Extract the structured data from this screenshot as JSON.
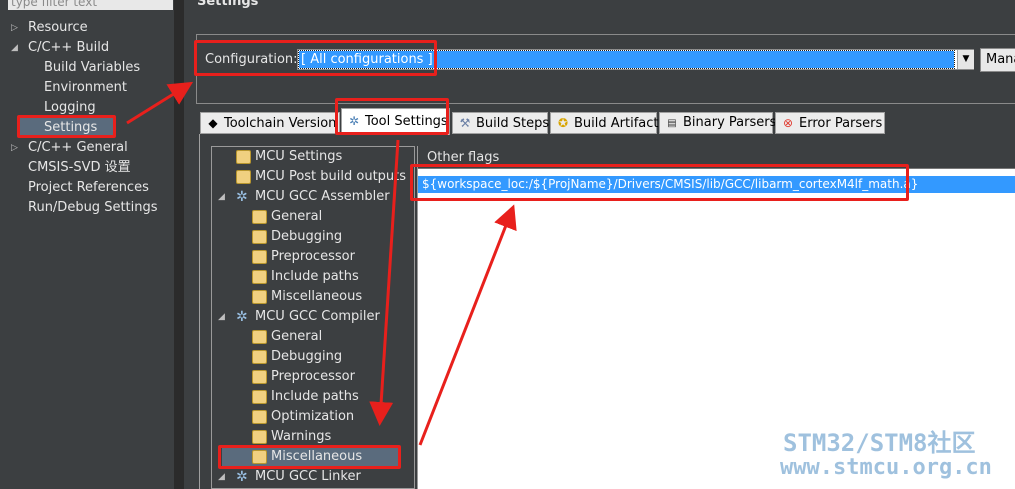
{
  "left_tree": {
    "filter_placeholder": "type filter text",
    "items": [
      {
        "label": "Resource",
        "expanded": false
      },
      {
        "label": "C/C++ Build",
        "expanded": true
      },
      {
        "label": "Build Variables"
      },
      {
        "label": "Environment"
      },
      {
        "label": "Logging"
      },
      {
        "label": "Settings",
        "selected": true
      },
      {
        "label": "C/C++ General",
        "expanded": false
      },
      {
        "label": "CMSIS-SVD 设置"
      },
      {
        "label": "Project References"
      },
      {
        "label": "Run/Debug Settings"
      }
    ]
  },
  "header": {
    "title": "Settings"
  },
  "configuration": {
    "label": "Configuration:",
    "value": "[ All configurations ]",
    "manage_label": "Mana"
  },
  "tabs": [
    {
      "label": "Toolchain  Version",
      "icon": "chip-icon"
    },
    {
      "label": "Tool Settings",
      "icon": "gear-icon",
      "active": true
    },
    {
      "label": "Build Steps",
      "icon": "wrench-icon"
    },
    {
      "label": "Build Artifact",
      "icon": "medal-icon"
    },
    {
      "label": "Binary Parsers",
      "icon": "binary-icon"
    },
    {
      "label": "Error Parsers",
      "icon": "error-icon"
    }
  ],
  "tool_tree": [
    {
      "label": "MCU Settings",
      "icon": "folder-gear-icon"
    },
    {
      "label": "MCU Post build outputs",
      "icon": "folder-gear-icon"
    },
    {
      "label": "MCU GCC Assembler",
      "icon": "gear-icon",
      "expanded": true
    },
    {
      "label": "General",
      "icon": "folder-gear-icon"
    },
    {
      "label": "Debugging",
      "icon": "folder-gear-icon"
    },
    {
      "label": "Preprocessor",
      "icon": "folder-gear-icon"
    },
    {
      "label": "Include paths",
      "icon": "folder-gear-icon"
    },
    {
      "label": "Miscellaneous",
      "icon": "folder-gear-icon"
    },
    {
      "label": "MCU GCC Compiler",
      "icon": "gear-icon",
      "expanded": true
    },
    {
      "label": "General",
      "icon": "folder-gear-icon"
    },
    {
      "label": "Debugging",
      "icon": "folder-gear-icon"
    },
    {
      "label": "Preprocessor",
      "icon": "folder-gear-icon"
    },
    {
      "label": "Include paths",
      "icon": "folder-gear-icon"
    },
    {
      "label": "Optimization",
      "icon": "folder-gear-icon"
    },
    {
      "label": "Warnings",
      "icon": "folder-gear-icon"
    },
    {
      "label": "Miscellaneous",
      "icon": "folder-gear-icon",
      "selected": true
    },
    {
      "label": "MCU GCC Linker",
      "icon": "gear-icon",
      "expanded": true
    }
  ],
  "other_flags": {
    "header": "Other flags",
    "value": "${workspace_loc:/${ProjName}/Drivers/CMSIS/lib/GCC/libarm_cortexM4lf_math.a}"
  },
  "watermark": {
    "line1": "STM32/STM8社区",
    "line2": "www.stmcu.org.cn"
  },
  "colors": {
    "selection": "#3399ff",
    "annotation": "#e8201c",
    "panel": "#3c3f41"
  }
}
